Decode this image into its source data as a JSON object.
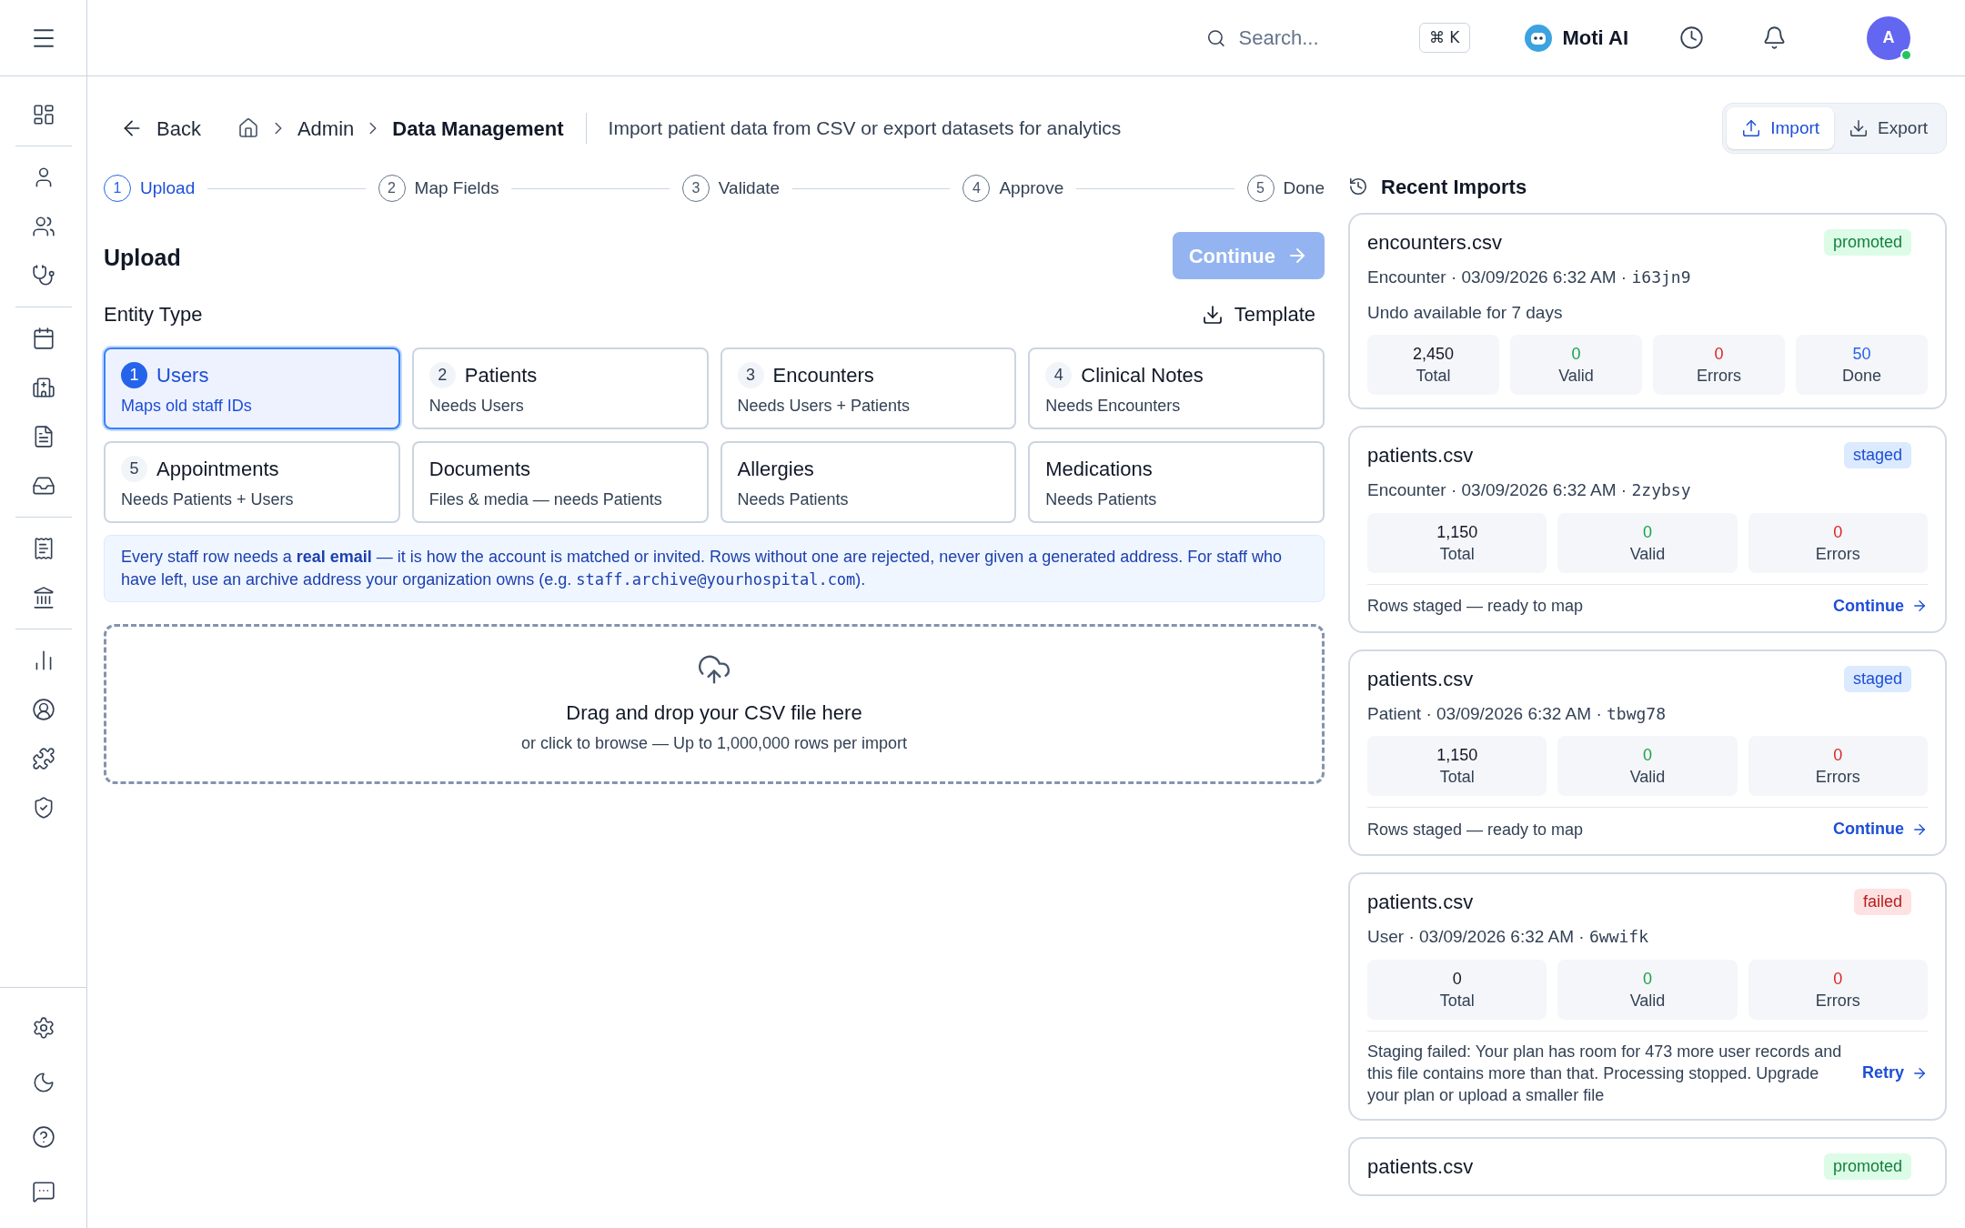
{
  "topbar": {
    "search_placeholder": "Search...",
    "shortcut": "⌘ K",
    "assistant": "Moti AI",
    "avatar": "A"
  },
  "header": {
    "back": "Back",
    "breadcrumbs": [
      "Admin",
      "Data Management"
    ],
    "description": "Import patient data from CSV or export datasets for analytics",
    "actions": [
      {
        "label": "Import",
        "selected": true
      },
      {
        "label": "Export",
        "selected": false
      }
    ]
  },
  "steps": [
    {
      "number": "1",
      "label": "Upload",
      "selected": true
    },
    {
      "number": "2",
      "label": "Map Fields",
      "selected": false
    },
    {
      "number": "3",
      "label": "Validate",
      "selected": false
    },
    {
      "number": "4",
      "label": "Approve",
      "selected": false
    },
    {
      "number": "5",
      "label": "Done",
      "selected": false
    }
  ],
  "upload": {
    "title": "Upload",
    "continue": {
      "label": "Continue",
      "disabled": true
    },
    "entity_label": "Entity Type",
    "template": "Template",
    "entities": [
      {
        "number": "1",
        "name": "Users",
        "hint": "Maps old staff IDs",
        "selected": true
      },
      {
        "number": "2",
        "name": "Patients",
        "hint": "Needs Users",
        "selected": false
      },
      {
        "number": "3",
        "name": "Encounters",
        "hint": "Needs Users + Patients",
        "selected": false
      },
      {
        "number": "4",
        "name": "Clinical Notes",
        "hint": "Needs Encounters",
        "selected": false
      },
      {
        "number": "5",
        "name": "Appointments",
        "hint": "Needs Patients + Users",
        "selected": false
      },
      {
        "name": "Documents",
        "hint": "Files & media — needs Patients",
        "selected": false
      },
      {
        "name": "Allergies",
        "hint": "Needs Patients",
        "selected": false
      },
      {
        "name": "Medications",
        "hint": "Needs Patients",
        "selected": false
      }
    ],
    "note": {
      "text": "Every staff row needs a **real email** — it is how the account is matched or invited. Rows without one are rejected, never given a generated address. For staff who have left, use an archive address your organization owns (e.g. ",
      "code": "staff.archive@yourhospital.com",
      "after": ")."
    },
    "dropzone": {
      "title": "Drag and drop your CSV file here",
      "subtitle": "or click to browse — Up to 1,000,000 rows per import"
    }
  },
  "recent": {
    "title": "Recent Imports",
    "items": [
      {
        "file": "encounters.csv",
        "status": "promoted",
        "meta": "Encounter · 03/09/2026 6:32 AM ·",
        "id": "i63jn9",
        "note": "Undo available for 7 days",
        "stats": [
          {
            "kind": "total",
            "value": "2,450",
            "label": "Total"
          },
          {
            "kind": "valid",
            "value": "0",
            "label": "Valid"
          },
          {
            "kind": "errors",
            "value": "0",
            "label": "Errors"
          },
          {
            "kind": "done",
            "value": "50",
            "label": "Done"
          }
        ]
      },
      {
        "file": "patients.csv",
        "status": "staged",
        "meta": "Encounter · 03/09/2026 6:32 AM ·",
        "id": "2zybsy",
        "stats": [
          {
            "kind": "total",
            "value": "1,150",
            "label": "Total"
          },
          {
            "kind": "valid",
            "value": "0",
            "label": "Valid"
          },
          {
            "kind": "errors",
            "value": "0",
            "label": "Errors"
          }
        ],
        "footer": {
          "message": "Rows staged — ready to map",
          "action": "Continue"
        }
      },
      {
        "file": "patients.csv",
        "status": "staged",
        "meta": "Patient · 03/09/2026 6:32 AM ·",
        "id": "tbwg78",
        "stats": [
          {
            "kind": "total",
            "value": "1,150",
            "label": "Total"
          },
          {
            "kind": "valid",
            "value": "0",
            "label": "Valid"
          },
          {
            "kind": "errors",
            "value": "0",
            "label": "Errors"
          }
        ],
        "footer": {
          "message": "Rows staged — ready to map",
          "action": "Continue"
        }
      },
      {
        "file": "patients.csv",
        "status": "failed",
        "meta": "User · 03/09/2026 6:32 AM ·",
        "id": "6wwifk",
        "stats": [
          {
            "kind": "total",
            "value": "0",
            "label": "Total"
          },
          {
            "kind": "valid",
            "value": "0",
            "label": "Valid"
          },
          {
            "kind": "errors",
            "value": "0",
            "label": "Errors"
          }
        ],
        "footer": {
          "message": "Staging failed: Your plan has room for 473 more user records and this file contains more than that. Processing stopped. Upgrade your plan or upload a smaller file",
          "action": "Retry"
        }
      },
      {
        "file": "patients.csv",
        "status": "promoted"
      }
    ]
  }
}
